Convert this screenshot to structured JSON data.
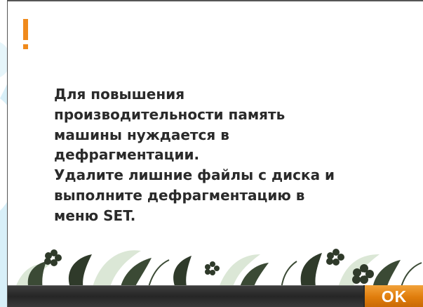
{
  "dialog": {
    "message_lines": [
      "Для повышения",
      "производительности память",
      "машины нуждается в",
      "дефрагментации.",
      "Удалите лишние файлы с диска и",
      "выполните дефрагментацию в",
      "меню SET."
    ],
    "ok_label": "OK",
    "icon": "warning-exclamation-icon"
  },
  "colors": {
    "accent": "#f08a1c",
    "text": "#2a2a2a",
    "bar": "#2c2c2c",
    "ok": "#e07d0c",
    "background_swirl": "#dff2f8"
  }
}
